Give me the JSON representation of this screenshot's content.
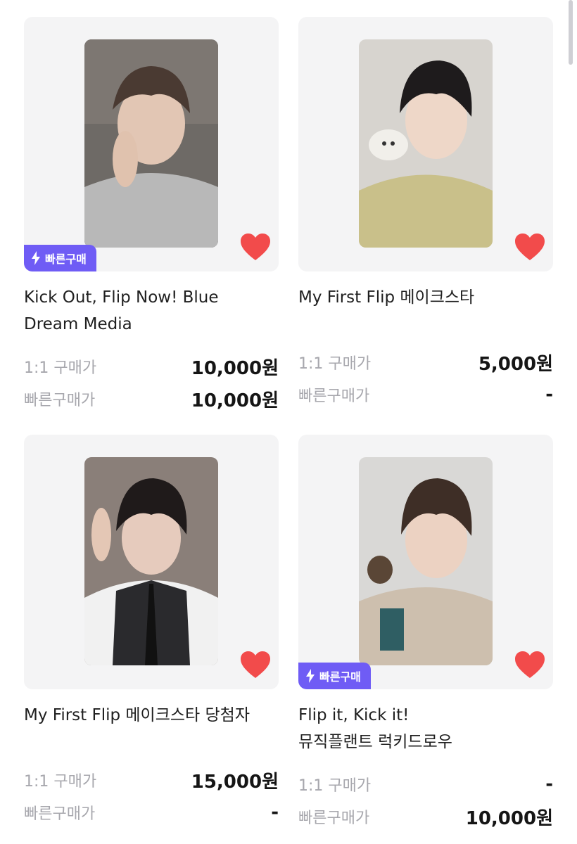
{
  "colors": {
    "accent": "#6f5cf5",
    "heart": "#f24b4b",
    "card_bg": "#f4f4f5",
    "label": "#a7a7ad"
  },
  "products": [
    {
      "title_lines": [
        "Kick Out, Flip Now! Blue",
        "Dream Media"
      ],
      "fast_badge": "빠른구매",
      "one_to_one_label": "1:1 구매가",
      "one_to_one_price": "10,000원",
      "fast_label": "빠른구매가",
      "fast_price": "10,000원"
    },
    {
      "title_lines": [
        "My First Flip 메이크스타"
      ],
      "fast_badge": "",
      "one_to_one_label": "1:1 구매가",
      "one_to_one_price": "5,000원",
      "fast_label": "빠른구매가",
      "fast_price": "-"
    },
    {
      "title_lines": [
        "My First Flip 메이크스타 당첨자"
      ],
      "fast_badge": "",
      "one_to_one_label": "1:1 구매가",
      "one_to_one_price": "15,000원",
      "fast_label": "빠른구매가",
      "fast_price": "-"
    },
    {
      "title_lines": [
        "Flip it, Kick it!",
        "뮤직플랜트 럭키드로우"
      ],
      "fast_badge": "빠른구매",
      "one_to_one_label": "1:1 구매가",
      "one_to_one_price": "-",
      "fast_label": "빠른구매가",
      "fast_price": "10,000원"
    }
  ]
}
